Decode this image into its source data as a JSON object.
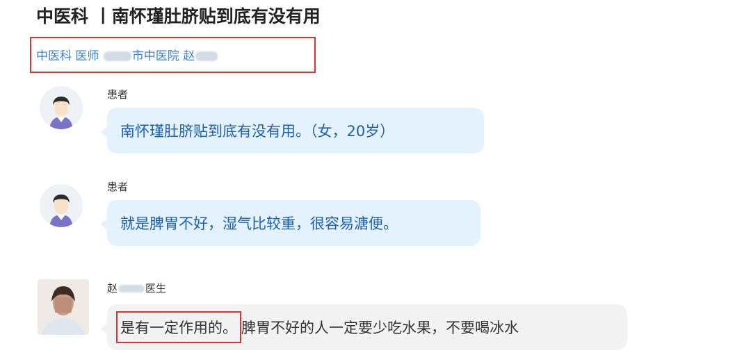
{
  "header": {
    "title": "中医科 丨南怀瑾肚脐贴到底有没有用",
    "subtitle_prefix": "中医科 医师",
    "subtitle_hospital": "市中医院 赵"
  },
  "messages": [
    {
      "role": "患者",
      "text": "南怀瑾肚脐贴到底有没有用。（女，20岁）"
    },
    {
      "role": "患者",
      "text": "就是脾胃不好，湿气比较重，很容易溏便。"
    },
    {
      "role_prefix": "赵",
      "role_suffix": "医生",
      "highlight": "是有一定作用的。",
      "text": "脾胃不好的人一定要少吃水果，不要喝冰水"
    }
  ],
  "colors": {
    "accent_blue": "#3f7fd1",
    "highlight_red": "#e03131",
    "patient_bubble": "#e3f2fd"
  }
}
